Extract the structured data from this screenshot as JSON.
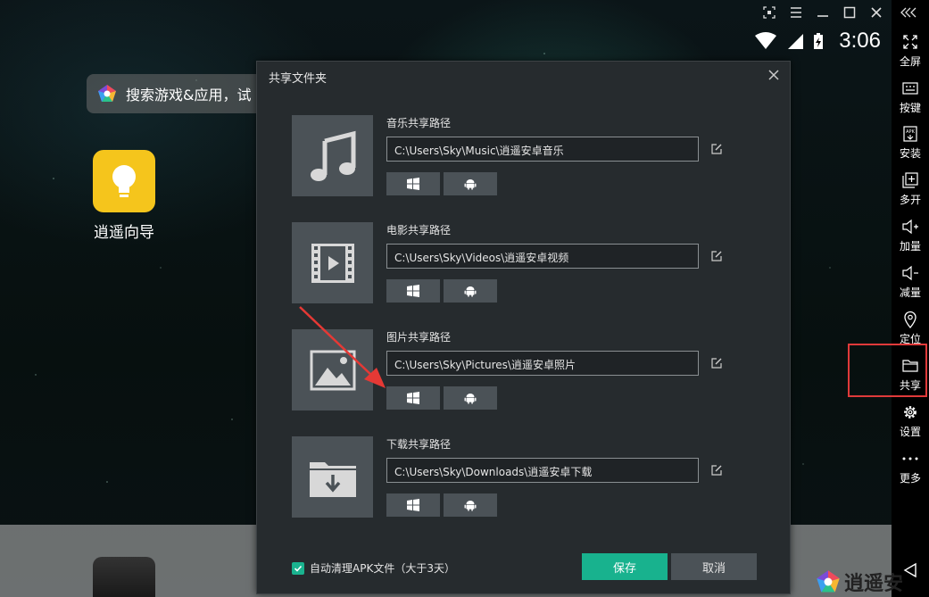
{
  "window_controls": {
    "screenshot_icon": "screenshot-icon",
    "menu_icon": "menu-icon",
    "minimize_icon": "minimize-icon",
    "maximize_icon": "maximize-icon",
    "close_icon": "close-icon",
    "collapse_icon": "collapse-icon"
  },
  "status_bar": {
    "time": "3:06"
  },
  "launcher": {
    "search_placeholder": "搜索游戏&应用，试",
    "app_guide_label": "逍遥向导"
  },
  "sidebar": {
    "items": [
      {
        "label": "全屏",
        "icon": "fullscreen-icon"
      },
      {
        "label": "按键",
        "icon": "keyboard-icon"
      },
      {
        "label": "安装",
        "icon": "apk-icon"
      },
      {
        "label": "多开",
        "icon": "multi-instance-icon"
      },
      {
        "label": "加量",
        "icon": "volume-up-icon"
      },
      {
        "label": "减量",
        "icon": "volume-down-icon"
      },
      {
        "label": "定位",
        "icon": "location-icon"
      },
      {
        "label": "共享",
        "icon": "folder-icon"
      },
      {
        "label": "设置",
        "icon": "gear-icon"
      },
      {
        "label": "更多",
        "icon": "more-icon"
      }
    ]
  },
  "dialog": {
    "title": "共享文件夹",
    "sections": [
      {
        "title": "音乐共享路径",
        "path": "C:\\Users\\Sky\\Music\\逍遥安卓音乐",
        "icon": "music-icon"
      },
      {
        "title": "电影共享路径",
        "path": "C:\\Users\\Sky\\Videos\\逍遥安卓视频",
        "icon": "video-icon"
      },
      {
        "title": "图片共享路径",
        "path": "C:\\Users\\Sky\\Pictures\\逍遥安卓照片",
        "icon": "image-icon"
      },
      {
        "title": "下载共享路径",
        "path": "C:\\Users\\Sky\\Downloads\\逍遥安卓下载",
        "icon": "download-folder-icon"
      }
    ],
    "auto_clean_label": "自动清理APK文件（大于3天）",
    "auto_clean_checked": true,
    "save_label": "保存",
    "cancel_label": "取消"
  },
  "brand": {
    "name": "逍遥安"
  },
  "colors": {
    "accent": "#18b28e",
    "highlight_border": "#e03a3a",
    "dialog_bg": "#262b2e"
  }
}
